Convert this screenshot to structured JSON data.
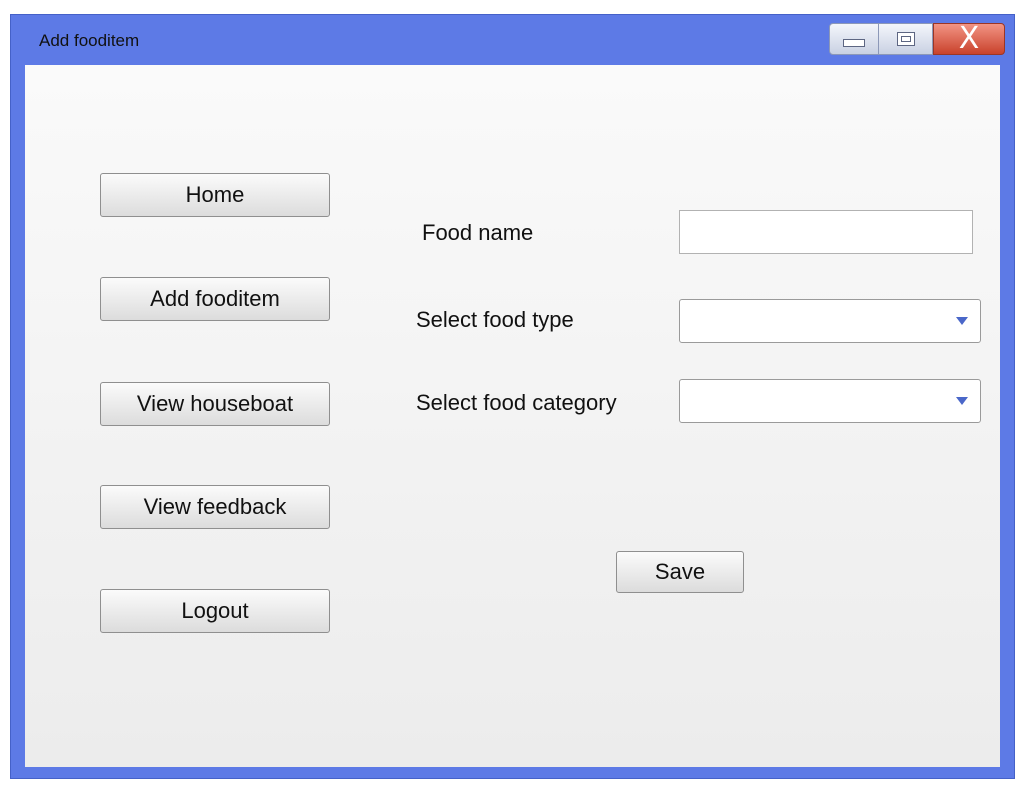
{
  "window": {
    "title": "Add fooditem",
    "controls": {
      "minimize_icon": "minimize-icon",
      "maximize_icon": "maximize-icon",
      "close_icon": "close-icon",
      "close_glyph": "X"
    }
  },
  "sidebar": {
    "items": [
      {
        "label": "Home"
      },
      {
        "label": "Add fooditem"
      },
      {
        "label": "View houseboat"
      },
      {
        "label": "View feedback"
      },
      {
        "label": "Logout"
      }
    ]
  },
  "form": {
    "food_name": {
      "label": "Food name",
      "value": ""
    },
    "food_type": {
      "label": "Select food type",
      "value": ""
    },
    "food_category": {
      "label": "Select food category",
      "value": ""
    },
    "save_label": "Save"
  },
  "colors": {
    "window_frame": "#5d7ae6",
    "close_button": "#d9543d",
    "dropdown_arrow": "#4a67c9"
  }
}
